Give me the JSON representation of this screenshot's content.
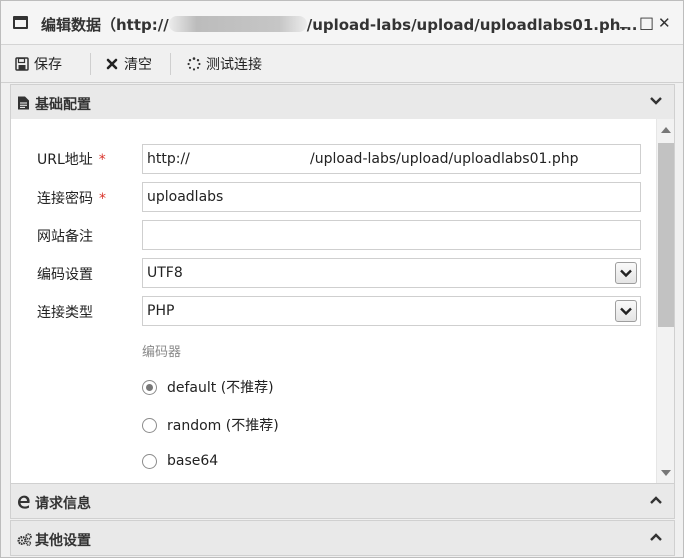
{
  "window": {
    "title_prefix": "编辑数据（http://",
    "title_suffix": "/upload-labs/upload/uploadlabs01.ph...",
    "minimize": "_",
    "maximize": "□",
    "close": "✕"
  },
  "toolbar": {
    "save_label": "保存",
    "clear_label": "清空",
    "test_label": "测试连接"
  },
  "sections": {
    "basic": "基础配置",
    "request": "请求信息",
    "other": "其他设置"
  },
  "form": {
    "url_label": "URL地址",
    "url_value": "http://                           /upload-labs/upload/uploadlabs01.php",
    "password_label": "连接密码",
    "password_value": "uploadlabs",
    "note_label": "网站备注",
    "note_value": "",
    "encoding_label": "编码设置",
    "encoding_value": "UTF8",
    "type_label": "连接类型",
    "type_value": "PHP",
    "required_mark": "*",
    "encoder_heading": "编码器",
    "encoders": [
      {
        "label": "default (不推荐)",
        "selected": true
      },
      {
        "label": "random (不推荐)",
        "selected": false
      },
      {
        "label": "base64",
        "selected": false
      }
    ]
  }
}
